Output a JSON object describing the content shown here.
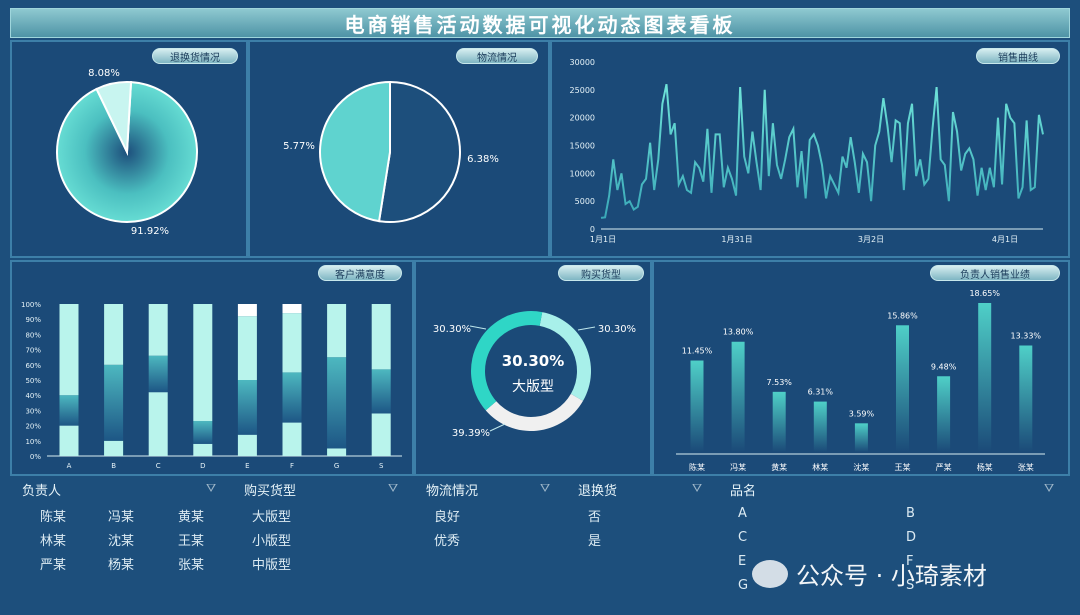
{
  "title": "电商销售活动数据可视化动态图表看板",
  "panels": {
    "returns": {
      "badge": "退换货情况"
    },
    "logistics": {
      "badge": "物流情况"
    },
    "sales_curve": {
      "badge": "销售曲线"
    },
    "satisfaction": {
      "badge": "客户满意度"
    },
    "purchase_type": {
      "badge": "购买货型",
      "center_value": "30.30%",
      "center_label": "大版型"
    },
    "person_sales": {
      "badge": "负责人销售业绩"
    }
  },
  "colors": {
    "accent": "#5fd3cf",
    "dark": "#1d4f7c",
    "panel": "#1b4a78",
    "border": "#3d7fa8"
  },
  "chart_data": [
    {
      "type": "pie",
      "name": "returns",
      "labels": [
        "8.08%",
        "91.92%"
      ],
      "values": [
        8.08,
        91.92
      ],
      "colors": [
        "#c8f5f0",
        "#5fd3cf"
      ]
    },
    {
      "type": "pie",
      "name": "logistics",
      "labels": [
        "6.38%",
        "5.77%"
      ],
      "values": [
        52.5,
        47.5
      ],
      "colors": [
        "#1d4f7c",
        "#5fd3cf"
      ]
    },
    {
      "type": "line",
      "name": "sales_curve",
      "yticks": [
        0,
        5000,
        10000,
        15000,
        20000,
        25000,
        30000
      ],
      "ylim": [
        0,
        30000
      ],
      "xticks": [
        "1月1日",
        "1月31日",
        "3月2日",
        "4月1日"
      ],
      "values": [
        2000,
        2100,
        6000,
        12500,
        7000,
        10000,
        4500,
        5000,
        3500,
        4000,
        8000,
        9000,
        15500,
        7000,
        12500,
        22500,
        26000,
        17000,
        19000,
        8000,
        9500,
        7000,
        6500,
        12000,
        11000,
        8500,
        18000,
        6500,
        17000,
        17000,
        7500,
        11000,
        9000,
        6000,
        25500,
        13000,
        10000,
        17500,
        12000,
        7000,
        25000,
        9500,
        19000,
        11500,
        9000,
        12500,
        16500,
        18000,
        7500,
        14000,
        5500,
        16000,
        17000,
        15000,
        11500,
        5500,
        9500,
        8000,
        6500,
        13000,
        11000,
        16500,
        12000,
        6500,
        13500,
        12000,
        5000,
        15000,
        17500,
        23500,
        18500,
        12000,
        19500,
        19000,
        7000,
        19000,
        22500,
        9500,
        12500,
        8000,
        9000,
        18000,
        25500,
        12500,
        11500,
        5000,
        21000,
        17500,
        10500,
        13500,
        14500,
        12500,
        6000,
        11000,
        7000,
        11000,
        7500,
        20000,
        8000,
        22500,
        20000,
        19000,
        5500,
        7500,
        19500,
        7000,
        7500,
        20500,
        17000
      ]
    },
    {
      "type": "bar",
      "name": "satisfaction",
      "stacked": true,
      "categories": [
        "A",
        "B",
        "C",
        "D",
        "E",
        "F",
        "G",
        "S"
      ],
      "yticks": [
        "0%",
        "10%",
        "20%",
        "30%",
        "40%",
        "50%",
        "60%",
        "70%",
        "80%",
        "90%",
        "100%"
      ],
      "series": [
        {
          "values": [
            20,
            10,
            42,
            8,
            14,
            22,
            5,
            28
          ],
          "color": "#b9f4ec"
        },
        {
          "values": [
            0,
            0,
            0,
            0,
            0,
            0,
            0,
            0
          ],
          "color": "#1ea685"
        },
        {
          "values": [
            20,
            50,
            24,
            15,
            36,
            33,
            60,
            29
          ],
          "color": "#3c9fb2"
        },
        {
          "values": [
            60,
            40,
            34,
            77,
            42,
            39,
            35,
            43
          ],
          "color": "#b9f4ec"
        },
        {
          "values": [
            0,
            0,
            0,
            0,
            8,
            6,
            0,
            0
          ],
          "color": "#ffffff"
        }
      ],
      "bottom_accent": [
        0,
        10,
        0,
        0,
        0,
        0,
        5,
        0
      ]
    },
    {
      "type": "pie",
      "name": "purchase_type",
      "donut": true,
      "labels": [
        "30.30%",
        "30.30%",
        "39.39%"
      ],
      "values": [
        30.3,
        30.3,
        39.39
      ],
      "colors": [
        "#a8f0ea",
        "#f0f0f0",
        "#2fd6c6"
      ]
    },
    {
      "type": "bar",
      "name": "person_sales",
      "categories": [
        "陈某",
        "冯某",
        "黄某",
        "林某",
        "沈某",
        "王某",
        "严某",
        "杨某",
        "张某"
      ],
      "values": [
        11.45,
        13.8,
        7.53,
        6.31,
        3.59,
        15.86,
        9.48,
        18.65,
        13.33
      ],
      "labels": [
        "11.45%",
        "13.80%",
        "7.53%",
        "6.31%",
        "3.59%",
        "15.86%",
        "9.48%",
        "18.65%",
        "13.33%"
      ]
    }
  ],
  "slicers": [
    {
      "header": "负责人",
      "items": [
        "陈某",
        "冯某",
        "黄某",
        "林某",
        "沈某",
        "王某",
        "严某",
        "杨某",
        "张某"
      ]
    },
    {
      "header": "购买货型",
      "items": [
        "大版型",
        "小版型",
        "中版型"
      ]
    },
    {
      "header": "物流情况",
      "items": [
        "良好",
        "优秀"
      ]
    },
    {
      "header": "退换货",
      "items": [
        "否",
        "是"
      ]
    },
    {
      "header": "品名",
      "items": [
        "A",
        "B",
        "C",
        "D",
        "E",
        "F",
        "G",
        "S"
      ]
    }
  ],
  "watermark": "公众号 · 小琦素材"
}
